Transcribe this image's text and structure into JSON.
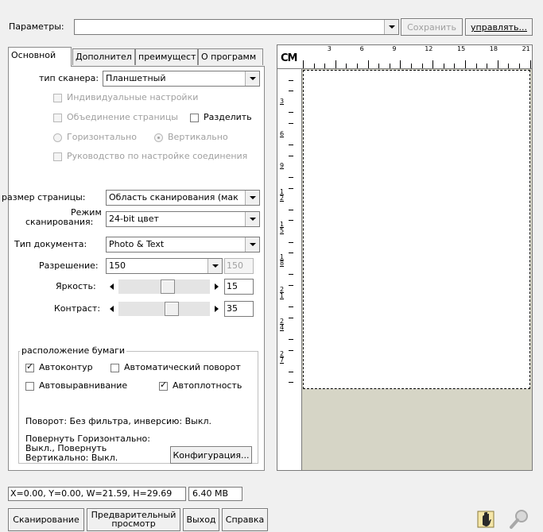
{
  "params": {
    "label": "Параметры:",
    "value": "",
    "save_label": "Сохранить",
    "manage_label": "управлять..."
  },
  "tabs": [
    "Основной",
    "Дополнител",
    "преимущест",
    "О программ"
  ],
  "scanner": {
    "type_label": "тип сканера:",
    "type_value": "Планшетный",
    "individual": "Индивидуальные настройки",
    "merge": "Объединение страницы",
    "split": "Разделить",
    "horizontal": "Горизонтально",
    "vertical": "Вертикально",
    "guide": "Руководство по настройке соединения"
  },
  "page": {
    "size_label": "размер страницы:",
    "size_value": "Область сканирования (мак",
    "mode_label_1": "Режим",
    "mode_label_2": "сканирования:",
    "mode_value": "24-bit цвет",
    "doctype_label": "Тип документа:",
    "doctype_value": "Photo & Text",
    "resolution_label": "Разрешение:",
    "resolution_value": "150",
    "resolution_display": "150",
    "brightness_label": "Яркость:",
    "brightness_value": "15",
    "brightness_level": 0.55,
    "contrast_label": "Контраст:",
    "contrast_value": "35",
    "contrast_level": 0.6
  },
  "paper": {
    "group_label": "расположение бумаги",
    "autocontour": "Автоконтур",
    "autorotate": "Автоматический поворот",
    "autoalign": "Автовыравнивание",
    "autodensity": "Автоплотность",
    "rotation_info": "Поворот: Без фильтра, инверсию: Выкл.",
    "flip_1": "Повернуть Горизонтально:",
    "flip_2": "Выкл., Повернуть",
    "flip_3": "Вертикально: Выкл.",
    "config_label": "Конфигурация..."
  },
  "ruler": {
    "unit": "СМ",
    "h_numbers": [
      "3",
      "6",
      "9",
      "12",
      "15",
      "18",
      "21"
    ],
    "v_numbers": [
      "3",
      "6",
      "9",
      "12",
      "15",
      "18",
      "21",
      "24",
      "27"
    ]
  },
  "status": {
    "coords": "X=0.00, Y=0.00, W=21.59, H=29.69",
    "size": "6.40 MB"
  },
  "bottom": {
    "scan": "Сканирование",
    "preview_1": "Предварительный",
    "preview_2": "просмотр",
    "exit": "Выход",
    "help": "Справка"
  },
  "colors": {
    "accent": "#000000",
    "preview_bg": "#d6d5c6",
    "scan_area": "#ffffff"
  }
}
